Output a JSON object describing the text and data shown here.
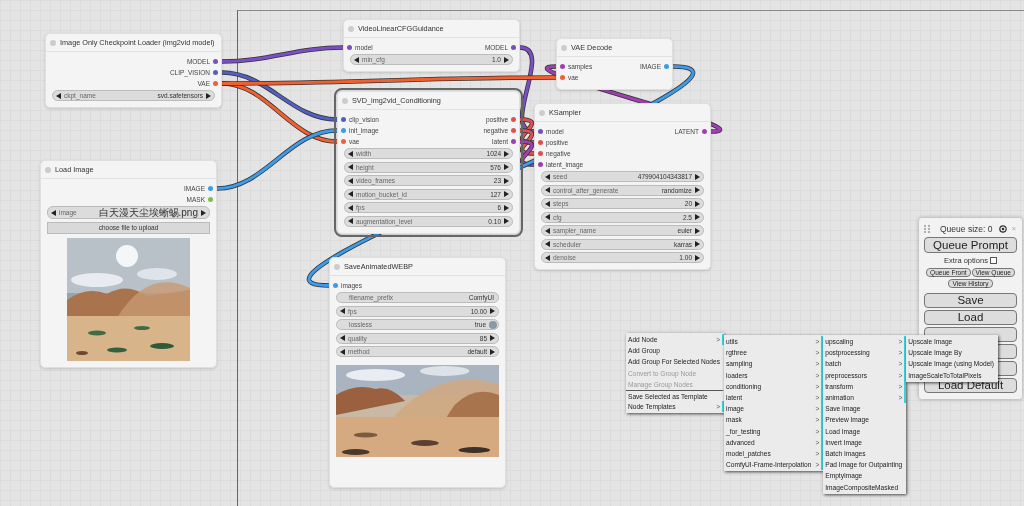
{
  "nodes": [
    {
      "title": "Image Only Checkpoint Loader (img2vid model)",
      "selected": false,
      "outputs": [
        {
          "name": "MODEL",
          "color": "#7b4fc4"
        },
        {
          "name": "CLIP_VISION",
          "color": "#5060c0"
        },
        {
          "name": "VAE",
          "color": "#f06030"
        }
      ],
      "widgets": [
        {
          "kind": "combo",
          "name": "ckpt_name",
          "value": "svd.safetensors"
        }
      ]
    },
    {
      "title": "Load Image",
      "selected": false,
      "outputs": [
        {
          "name": "IMAGE",
          "color": "#3d9be9"
        },
        {
          "name": "MASK",
          "color": "#7ac050"
        }
      ],
      "widgets": [
        {
          "kind": "combo",
          "name": "image",
          "value": "白天漫天尘埃蜥蜴.png"
        },
        {
          "kind": "button",
          "name": "choose file to upload"
        }
      ],
      "preview": {
        "kind": "picture"
      }
    },
    {
      "title": "VideoLinearCFGGuidance",
      "selected": false,
      "inputs": [
        {
          "name": "model",
          "color": "#7b4fc4"
        }
      ],
      "outputs": [
        {
          "name": "MODEL",
          "color": "#7b4fc4"
        }
      ],
      "widgets": [
        {
          "kind": "number",
          "name": "min_cfg",
          "value": "1.0"
        }
      ]
    },
    {
      "title": "SVD_img2vid_Conditioning",
      "selected": true,
      "inputs": [
        {
          "name": "clip_vision",
          "color": "#5060c0"
        },
        {
          "name": "init_image",
          "color": "#3d9be9"
        },
        {
          "name": "vae",
          "color": "#f06030"
        }
      ],
      "outputs": [
        {
          "name": "positive",
          "color": "#e05050"
        },
        {
          "name": "negative",
          "color": "#e05050"
        },
        {
          "name": "latent",
          "color": "#a040b0"
        }
      ],
      "widgets": [
        {
          "kind": "number",
          "name": "width",
          "value": "1024"
        },
        {
          "kind": "number",
          "name": "height",
          "value": "576"
        },
        {
          "kind": "number",
          "name": "video_frames",
          "value": "23"
        },
        {
          "kind": "number",
          "name": "motion_bucket_id",
          "value": "127"
        },
        {
          "kind": "number",
          "name": "fps",
          "value": "6"
        },
        {
          "kind": "number",
          "name": "augmentation_level",
          "value": "0.10"
        }
      ]
    },
    {
      "title": "SaveAnimatedWEBP",
      "selected": false,
      "inputs": [
        {
          "name": "images",
          "color": "#3d9be9"
        }
      ],
      "widgets": [
        {
          "kind": "text",
          "name": "filename_prefix",
          "value": "ComfyUI"
        },
        {
          "kind": "number",
          "name": "fps",
          "value": "10.00"
        },
        {
          "kind": "toggle",
          "name": "lossless",
          "value": "true",
          "on": true
        },
        {
          "kind": "number",
          "name": "quality",
          "value": "85"
        },
        {
          "kind": "combo",
          "name": "method",
          "value": "default"
        }
      ],
      "preview": {
        "kind": "picture"
      }
    },
    {
      "title": "VAE Decode",
      "selected": false,
      "inputs": [
        {
          "name": "samples",
          "color": "#a040b0"
        },
        {
          "name": "vae",
          "color": "#f06030"
        }
      ],
      "outputs": [
        {
          "name": "IMAGE",
          "color": "#3d9be9"
        }
      ]
    },
    {
      "title": "KSampler",
      "selected": false,
      "inputs": [
        {
          "name": "model",
          "color": "#7b4fc4"
        },
        {
          "name": "positive",
          "color": "#e05050"
        },
        {
          "name": "negative",
          "color": "#e05050"
        },
        {
          "name": "latent_image",
          "color": "#a040b0"
        }
      ],
      "outputs": [
        {
          "name": "LATENT",
          "color": "#a040b0"
        }
      ],
      "widgets": [
        {
          "kind": "number",
          "name": "seed",
          "value": "479904104343817"
        },
        {
          "kind": "combo",
          "name": "control_after_generate",
          "value": "randomize"
        },
        {
          "kind": "number",
          "name": "steps",
          "value": "20"
        },
        {
          "kind": "number",
          "name": "cfg",
          "value": "2.5"
        },
        {
          "kind": "combo",
          "name": "sampler_name",
          "value": "euler"
        },
        {
          "kind": "combo",
          "name": "scheduler",
          "value": "karras"
        },
        {
          "kind": "number",
          "name": "denoise",
          "value": "1.00"
        }
      ]
    }
  ],
  "context_menus": [
    {
      "items": [
        {
          "label": "Add Node",
          "arrow": ">",
          "disabled": false
        },
        {
          "label": "Add Group",
          "disabled": false
        },
        {
          "label": "Add Group For Selected Nodes",
          "disabled": false
        },
        {
          "label": "Convert to Group Node",
          "disabled": true
        },
        {
          "label": "Manage Group Nodes",
          "disabled": true
        },
        {
          "label": "Save Selected as Template",
          "disabled": false,
          "separator_before": true
        },
        {
          "label": "Node Templates",
          "arrow": ">",
          "disabled": false
        }
      ]
    },
    {
      "items": [
        {
          "label": "utils",
          "arrow": ">"
        },
        {
          "label": "rgthree",
          "arrow": ">"
        },
        {
          "label": "sampling",
          "arrow": ">"
        },
        {
          "label": "loaders",
          "arrow": ">"
        },
        {
          "label": "conditioning",
          "arrow": ">"
        },
        {
          "label": "latent",
          "arrow": ">"
        },
        {
          "label": "image",
          "arrow": ">"
        },
        {
          "label": "mask",
          "arrow": ">"
        },
        {
          "label": "_for_testing",
          "arrow": ">"
        },
        {
          "label": "advanced",
          "arrow": ">"
        },
        {
          "label": "model_patches",
          "arrow": ">"
        },
        {
          "label": "ComfyUI-Frame-Interpolation",
          "arrow": ">"
        }
      ]
    },
    {
      "items": [
        {
          "label": "upscaling",
          "arrow": ">"
        },
        {
          "label": "postprocessing",
          "arrow": ">"
        },
        {
          "label": "batch",
          "arrow": ">"
        },
        {
          "label": "preprocessors",
          "arrow": ">"
        },
        {
          "label": "transform",
          "arrow": ">"
        },
        {
          "label": "animation",
          "arrow": ">"
        },
        {
          "label": "Save Image"
        },
        {
          "label": "Preview Image"
        },
        {
          "label": "Load Image"
        },
        {
          "label": "Invert Image"
        },
        {
          "label": "Batch Images"
        },
        {
          "label": "Pad Image for Outpainting"
        },
        {
          "label": "EmptyImage"
        },
        {
          "label": "ImageCompositeMasked"
        }
      ]
    },
    {
      "items": [
        {
          "label": "Upscale Image"
        },
        {
          "label": "Upscale Image By"
        },
        {
          "label": "Upscale Image (using Model)"
        },
        {
          "label": "ImageScaleToTotalPixels"
        }
      ]
    }
  ],
  "queue_panel": {
    "queue_size": "Queue size: 0",
    "close": "×",
    "primary_button": "Queue Prompt",
    "extra_options": {
      "label": "Extra options",
      "checked": false
    },
    "small_buttons": [
      "Queue Front",
      "View Queue",
      "View History"
    ],
    "buttons": [
      {
        "kind": "button",
        "label": "Save"
      },
      {
        "kind": "button",
        "label": "Load"
      },
      {
        "kind": "covered"
      },
      {
        "kind": "covered"
      },
      {
        "kind": "covered"
      },
      {
        "kind": "button",
        "label": "Load Default"
      }
    ]
  }
}
